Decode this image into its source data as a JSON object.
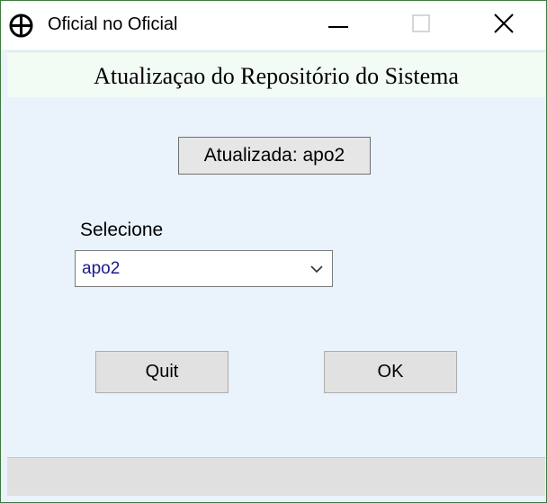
{
  "window": {
    "title": "Oficial no Oficial",
    "app_icon": "crosshair-circle-icon",
    "controls": {
      "minimize_icon": "minimize-icon",
      "maximize_icon": "maximize-icon",
      "close_icon": "close-icon"
    }
  },
  "header": {
    "title": "Atualizaçao do Repositório do Sistema"
  },
  "status": {
    "text": "Atualizada: apo2"
  },
  "selector": {
    "label": "Selecione",
    "selected_value": "apo2",
    "dropdown_icon": "chevron-down-icon"
  },
  "buttons": {
    "quit_label": "Quit",
    "ok_label": "OK"
  },
  "colors": {
    "window_bg": "#eaf3fb",
    "header_band_bg": "#f3fbf5",
    "selected_value_text": "#1a1a8c",
    "button_bg": "#e1e1e1",
    "outer_border": "#2f6b2f"
  }
}
